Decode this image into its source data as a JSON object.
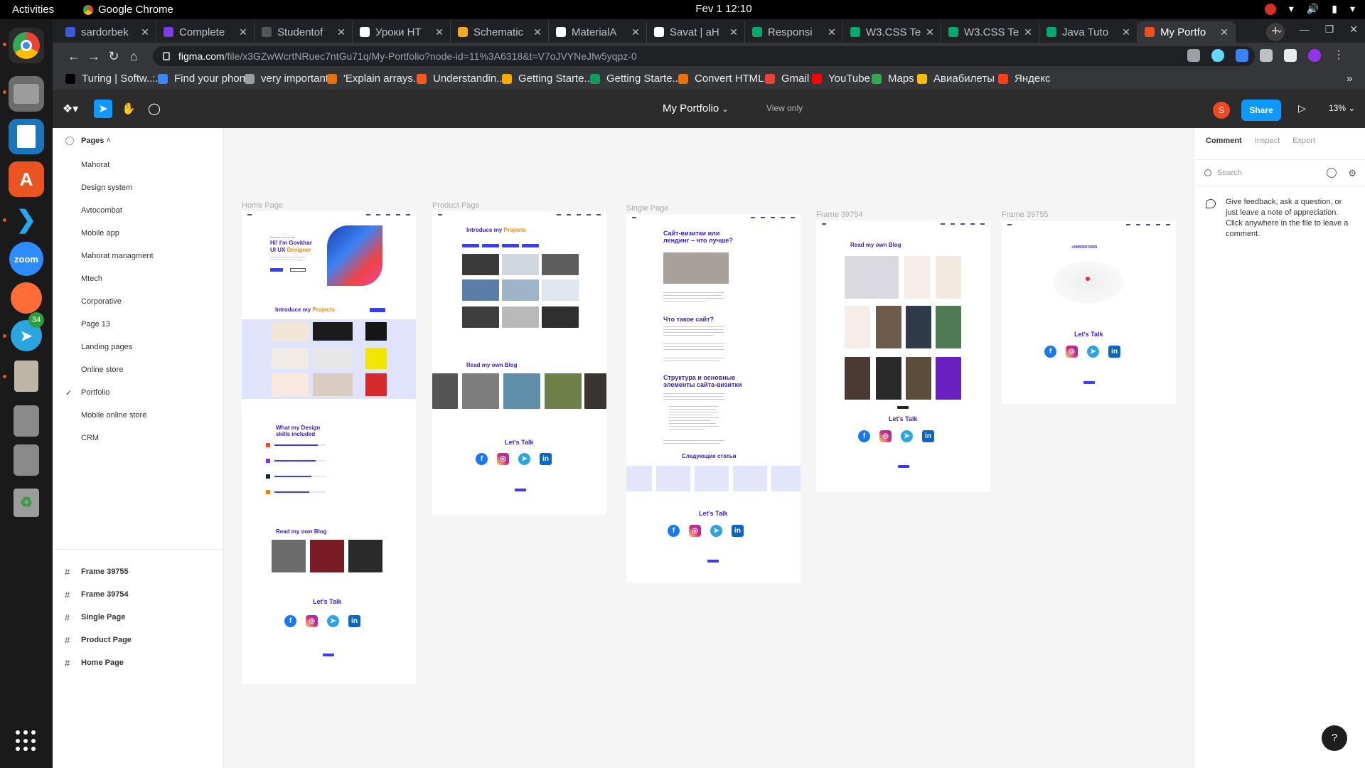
{
  "system": {
    "activities": "Activities",
    "app_name": "Google Chrome",
    "clock": "Fev 1  12:10"
  },
  "dock": {
    "telegram_badge": "34",
    "zoom_label": "zoom"
  },
  "tabs": [
    {
      "label": "sardorbek",
      "color": "#3b5bdb"
    },
    {
      "label": "Complete",
      "color": "#7b3fe4"
    },
    {
      "label": "Studentof",
      "color": "#555555"
    },
    {
      "label": "Уроки HT",
      "color": "#ffffff"
    },
    {
      "label": "Schematic",
      "color": "#f5a623"
    },
    {
      "label": "MaterialA",
      "color": "#ffffff"
    },
    {
      "label": "Savat | aH",
      "color": "#ffffff"
    },
    {
      "label": "Responsi",
      "color": "#04aa6d"
    },
    {
      "label": "W3.CSS Te",
      "color": "#04aa6d"
    },
    {
      "label": "W3.CSS Te",
      "color": "#04aa6d"
    },
    {
      "label": "Java Tuto",
      "color": "#04aa6d"
    },
    {
      "label": "My Portfo",
      "color": "#f24e1e"
    }
  ],
  "address_bar": {
    "host": "figma.com",
    "path": "/file/x3GZwWcrtNRuec7ntGu71q/My-Portfolio?node-id=11%3A6318&t=V7oJVYNeJfw5yqpz-0"
  },
  "bookmarks": [
    {
      "label": "Turing | Softw..:.",
      "color": "#000000"
    },
    {
      "label": "Find your phone",
      "color": "#4285f4"
    },
    {
      "label": "very important+",
      "color": "#9e9e9e"
    },
    {
      "label": "'Explain arrays...",
      "color": "#e8710a"
    },
    {
      "label": "Understandin...",
      "color": "#ff5722"
    },
    {
      "label": "Getting Starte...",
      "color": "#f9ab00"
    },
    {
      "label": "Getting Starte...",
      "color": "#0f9d58"
    },
    {
      "label": "Convert HTML.:.",
      "color": "#e8710a"
    },
    {
      "label": "Gmail",
      "color": "#ea4335"
    },
    {
      "label": "YouTube",
      "color": "#ff0000"
    },
    {
      "label": "Maps",
      "color": "#34a853"
    },
    {
      "label": "Авиабилеты",
      "color": "#fbbc04"
    },
    {
      "label": "Яндекс",
      "color": "#fc3f1d"
    }
  ],
  "figma": {
    "file_title": "My Portfolio",
    "view_only": "View only",
    "avatar_initial": "S",
    "share_label": "Share",
    "zoom": "13%"
  },
  "left_panel": {
    "pages_header": "Pages",
    "pages": [
      {
        "label": "Mahorat",
        "active": false
      },
      {
        "label": "Design system",
        "active": false
      },
      {
        "label": "Avtocombat",
        "active": false
      },
      {
        "label": "Mobile app",
        "active": false
      },
      {
        "label": "Mahorat managment",
        "active": false
      },
      {
        "label": "Mtech",
        "active": false
      },
      {
        "label": "Corporative",
        "active": false
      },
      {
        "label": "Page 13",
        "active": false
      },
      {
        "label": "Landing pages",
        "active": false
      },
      {
        "label": "Online store",
        "active": false
      },
      {
        "label": "Portfolio",
        "active": true
      },
      {
        "label": "Mobile online store",
        "active": false
      },
      {
        "label": "CRM",
        "active": false
      }
    ],
    "layers": [
      "Frame 39755",
      "Frame 39754",
      "Single Page",
      "Product Page",
      "Home Page"
    ]
  },
  "canvas": {
    "frame_labels": [
      "Home Page",
      "Product Page",
      "Single Page",
      "Frame 39754",
      "Frame 39755"
    ],
    "home": {
      "hero_greet": "Welcome to my site",
      "hero_title_1": "Hi! I'm Govkhar",
      "hero_title_2a": "UI UX ",
      "hero_title_2b": "Designer",
      "projects_a": "Introduce my ",
      "projects_b": "Projects",
      "skills_title_1": "What my Design",
      "skills_title_2": "skills included",
      "skills_levels": [
        0.85,
        0.8,
        0.72,
        0.68
      ],
      "blog_title": "Read my own Blog",
      "lets_talk": "Let's Talk"
    },
    "product": {
      "projects_a": "Introduce my ",
      "projects_b": "Projects",
      "blog_title": "Read my own Blog",
      "lets_talk": "Let's Talk"
    },
    "single": {
      "title_1": "Сайт-визитки или",
      "title_2": "лендинг – что лучше?",
      "section_1": "Что такое сайт?",
      "section_2a": "Структура и основные",
      "section_2b": "элементы сайта-визитки",
      "next_articles": "Следующие статьи",
      "lets_talk": "Let's Talk"
    },
    "frame39754": {
      "blog_title": "Read my own Blog",
      "lets_talk": "Let's Talk"
    },
    "frame39755": {
      "phone": "+998930076505",
      "lets_talk": "Let's Talk"
    }
  },
  "right_panel": {
    "tabs": [
      "Comment",
      "Inspect",
      "Export"
    ],
    "search_placeholder": "Search",
    "hint": "Give feedback, ask a question, or just leave a note of appreciation. Click anywhere in the file to leave a comment."
  },
  "help_label": "?"
}
